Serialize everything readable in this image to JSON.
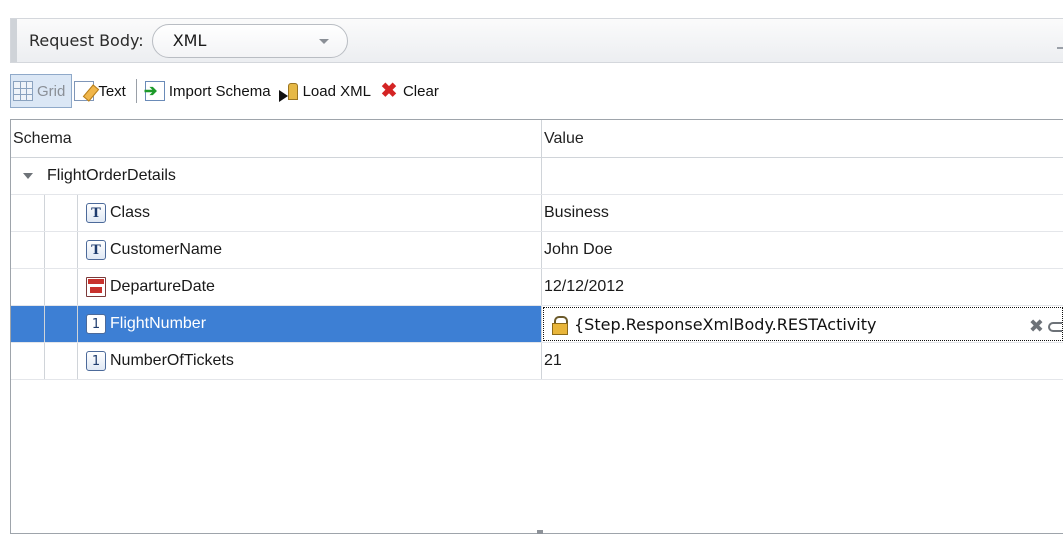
{
  "header": {
    "label": "Request Body:",
    "body_type": "XML"
  },
  "toolbar": {
    "grid_label": "Grid",
    "text_label": "Text",
    "import_schema_label": "Import Schema",
    "load_xml_label": "Load XML",
    "clear_label": "Clear"
  },
  "grid": {
    "columns": {
      "schema": "Schema",
      "value": "Value"
    },
    "parent": {
      "name": "FlightOrderDetails",
      "value": ""
    },
    "rows": [
      {
        "name": "Class",
        "type_icon": "T",
        "icon": "text-type-icon",
        "value": "Business"
      },
      {
        "name": "CustomerName",
        "type_icon": "T",
        "icon": "text-type-icon",
        "value": "John Doe"
      },
      {
        "name": "DepartureDate",
        "type_icon": "",
        "icon": "date-type-icon",
        "value": "12/12/2012"
      },
      {
        "name": "FlightNumber",
        "type_icon": "1",
        "icon": "number-type-icon",
        "value": "{Step.ResponseXmlBody.RESTActivity",
        "selected": true,
        "locked": true
      },
      {
        "name": "NumberOfTickets",
        "type_icon": "1",
        "icon": "number-type-icon",
        "value": "21"
      }
    ]
  },
  "colors": {
    "selection": "#3d7fd4",
    "clear_icon": "#d42424",
    "import_arrow": "#1d9a2a"
  }
}
